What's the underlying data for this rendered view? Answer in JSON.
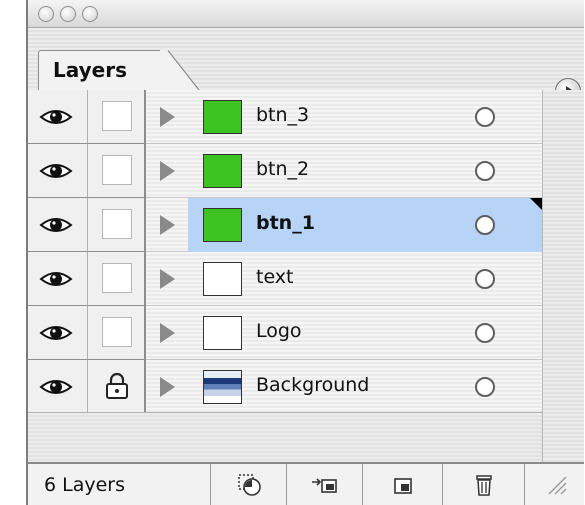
{
  "window": {
    "tab_label": "Layers"
  },
  "layers": [
    {
      "name": "btn_3",
      "thumb": "green",
      "locked": false,
      "selected": false
    },
    {
      "name": "btn_2",
      "thumb": "green",
      "locked": false,
      "selected": false
    },
    {
      "name": "btn_1",
      "thumb": "green",
      "locked": false,
      "selected": true
    },
    {
      "name": "text",
      "thumb": "white",
      "locked": false,
      "selected": false
    },
    {
      "name": "Logo",
      "thumb": "white",
      "locked": false,
      "selected": false
    },
    {
      "name": "Background",
      "thumb": "photo",
      "locked": true,
      "selected": false
    }
  ],
  "footer": {
    "layer_count": "6 Layers",
    "buttons": [
      "release-to-layers-icon",
      "move-to-layer-icon",
      "new-layer-icon",
      "trash-icon"
    ]
  },
  "colors": {
    "selection": "#b7d3f6",
    "thumb_green": "#3dc423"
  }
}
